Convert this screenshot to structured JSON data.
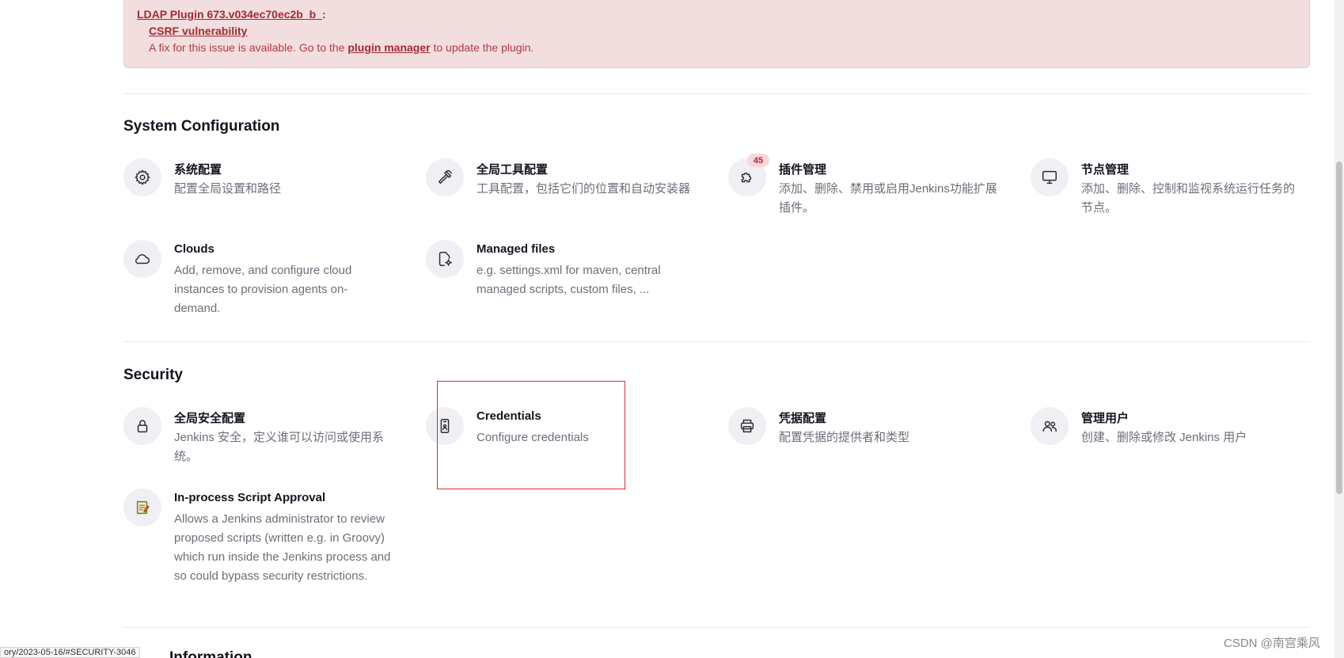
{
  "alert": {
    "plugin_label": "LDAP Plugin 673.v034ec70ec2b_b_",
    "plugin_colon": ":",
    "vulnerability": "CSRF vulnerability",
    "fix_prefix": "A fix for this issue is available. Go to the",
    "fix_link": "plugin manager",
    "fix_suffix": "to update the plugin."
  },
  "system_configuration": {
    "title": "System Configuration",
    "items": [
      {
        "name": "系统配置",
        "desc": "配置全局设置和路径",
        "icon": "gear-icon"
      },
      {
        "name": "全局工具配置",
        "desc": "工具配置，包括它们的位置和自动安装器",
        "icon": "hammer-icon"
      },
      {
        "name": "插件管理",
        "desc": "添加、删除、禁用或启用Jenkins功能扩展插件。",
        "icon": "puzzle-icon",
        "badge": "45"
      },
      {
        "name": "节点管理",
        "desc": "添加、删除、控制和监视系统运行任务的节点。",
        "icon": "monitor-icon"
      },
      {
        "name": "Clouds",
        "desc": "Add, remove, and configure cloud instances to provision agents on-demand.",
        "icon": "cloud-icon"
      },
      {
        "name": "Managed files",
        "desc": "e.g. settings.xml for maven, central managed scripts, custom files, ...",
        "icon": "file-gear-icon"
      }
    ]
  },
  "security": {
    "title": "Security",
    "items": [
      {
        "name": "全局安全配置",
        "desc": "Jenkins 安全，定义谁可以访问或使用系统。",
        "icon": "lock-icon"
      },
      {
        "name": "Credentials",
        "desc": "Configure credentials",
        "icon": "id-card-icon"
      },
      {
        "name": "凭据配置",
        "desc": "配置凭据的提供者和类型",
        "icon": "printer-icon"
      },
      {
        "name": "管理用户",
        "desc": "创建、删除或修改 Jenkins 用户",
        "icon": "users-icon"
      },
      {
        "name": "In-process Script Approval",
        "desc": "Allows a Jenkins administrator to review proposed scripts (written e.g. in Groovy) which run inside the Jenkins process and so could bypass security restrictions.",
        "icon": "notepad-icon"
      }
    ]
  },
  "next_section_partial": "Information",
  "status_bar_url": "ory/2023-05-16/#SECURITY-3046",
  "watermark": "CSDN @南宫乘风",
  "colors": {
    "alert_bg": "#f2dede",
    "alert_text": "#a12b35",
    "highlight_border": "#e22a2a",
    "badge_bg": "#f7d8da"
  }
}
